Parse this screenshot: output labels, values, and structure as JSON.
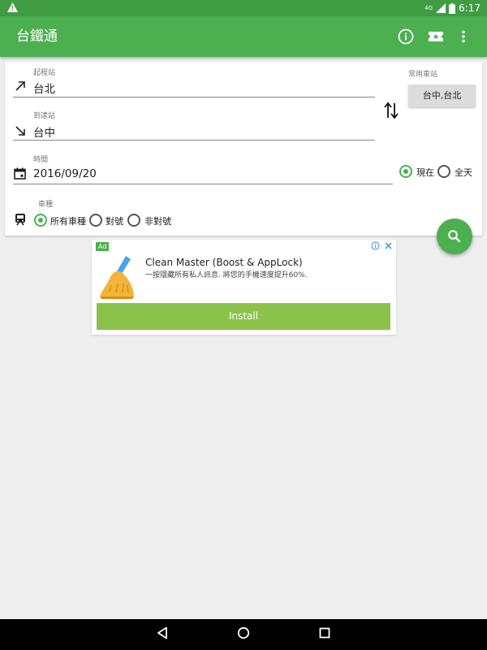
{
  "status_bar": {
    "signal": "4G",
    "time": "6:17"
  },
  "app_bar": {
    "title": "台鐵通"
  },
  "form": {
    "from": {
      "label": "起程站",
      "value": "台北"
    },
    "to": {
      "label": "到達站",
      "value": "台中"
    },
    "favorites": {
      "label": "常用車站",
      "button": "台中,台北"
    },
    "time": {
      "label": "時間",
      "value": "2016/09/20"
    },
    "time_mode": {
      "options": [
        "現在",
        "全天"
      ],
      "selected": "現在"
    },
    "train_type": {
      "label": "車種",
      "options": [
        "所有車種",
        "對號",
        "非對號"
      ],
      "selected": "所有車種"
    }
  },
  "ad": {
    "badge": "Ad",
    "title": "Clean Master (Boost & AppLock)",
    "description": "一按隱藏所有私人訊息. 將您的手機速度提升60%.",
    "cta": "Install"
  },
  "colors": {
    "primary": "#4caf50",
    "status": "#3f9c43",
    "install": "#8bc34a"
  }
}
